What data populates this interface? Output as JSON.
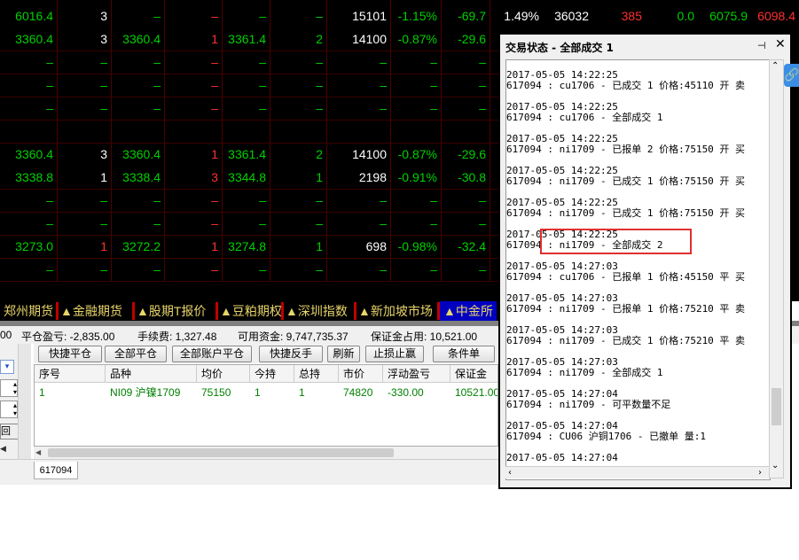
{
  "quote_table": {
    "rows": [
      [
        "6016.4",
        "3",
        "–",
        "–",
        "–",
        "–",
        "15101",
        "-1.15%",
        "-69.7",
        "1.49%",
        "36032",
        "385",
        "0.0",
        "6075.9",
        "6098.4"
      ],
      [
        "3360.4",
        "3",
        "3360.4",
        "1",
        "3361.4",
        "2",
        "14100",
        "-0.87%",
        "-29.6",
        "",
        "",
        "",
        "",
        "",
        ""
      ],
      [
        "–",
        "–",
        "–",
        "–",
        "–",
        "–",
        "–",
        "–",
        "–",
        "",
        "",
        "",
        "",
        "",
        ""
      ],
      [
        "–",
        "–",
        "–",
        "–",
        "–",
        "–",
        "–",
        "–",
        "–",
        "",
        "",
        "",
        "",
        "",
        ""
      ],
      [
        "–",
        "–",
        "–",
        "–",
        "–",
        "–",
        "–",
        "–",
        "–",
        "",
        "",
        "",
        "",
        "",
        ""
      ],
      [
        "3360.4",
        "3",
        "3360.4",
        "1",
        "3361.4",
        "2",
        "14100",
        "-0.87%",
        "-29.6",
        "",
        "",
        "",
        "",
        "",
        ""
      ],
      [
        "3338.8",
        "1",
        "3338.4",
        "3",
        "3344.8",
        "1",
        "2198",
        "-0.91%",
        "-30.8",
        "",
        "",
        "",
        "",
        "",
        ""
      ],
      [
        "–",
        "–",
        "–",
        "–",
        "–",
        "–",
        "–",
        "–",
        "–",
        "",
        "",
        "",
        "",
        "",
        ""
      ],
      [
        "–",
        "–",
        "–",
        "–",
        "–",
        "–",
        "–",
        "–",
        "–",
        "",
        "",
        "",
        "",
        "",
        ""
      ],
      [
        "3273.0",
        "1",
        "3272.2",
        "1",
        "3274.8",
        "1",
        "698",
        "-0.98%",
        "-32.4",
        "",
        "",
        "",
        "",
        "",
        ""
      ],
      [
        "–",
        "–",
        "–",
        "–",
        "–",
        "–",
        "–",
        "–",
        "–",
        "",
        "",
        "",
        "",
        "",
        ""
      ]
    ],
    "colors": {
      "up": "#00d000",
      "down": "#ff3030",
      "neutral": "#ffffff",
      "dash_green": "#00d000",
      "dash_red": "#ff3030"
    }
  },
  "exchange_tabs": [
    "郑州期货",
    "▲金融期货",
    "▲股期T报价",
    "▲豆粕期权",
    "▲深圳指数",
    "▲新加坡市场",
    "▲中金所"
  ],
  "account_bar": {
    "prefix": "00",
    "close_pl": "平仓盈亏: -2,835.00",
    "fee": "手续费: 1,327.48",
    "available": "可用资金: 9,747,735.37",
    "margin": "保证金占用: 10,521.00"
  },
  "toolbar": [
    "快捷平仓",
    "全部平仓",
    "全部账户平仓",
    "快捷反手",
    "刷新",
    "止损止赢",
    "条件单"
  ],
  "positions": {
    "headers": [
      "序号",
      "品种",
      "均价",
      "今持",
      "总持",
      "市价",
      "浮动盈亏",
      "保证金"
    ],
    "rows": [
      [
        "1",
        "NI09 沪镍1709",
        "75150",
        "1",
        "1",
        "74820",
        "-330.00",
        "10521.00"
      ]
    ]
  },
  "account_tab": "617094",
  "left_panel": {
    "button_label": "回"
  },
  "dialog": {
    "title": "交易状态 - 全部成交 1",
    "entries": [
      {
        "time": "2017-05-05 14:22:25",
        "msg": "617094 : cu1706 - 已成交 1 价格:45110 开 卖"
      },
      {
        "time": "2017-05-05 14:22:25",
        "msg": "617094 : cu1706 - 全部成交 1"
      },
      {
        "time": "2017-05-05 14:22:25",
        "msg": "617094 : ni1709 - 已报单 2 价格:75150 开 买"
      },
      {
        "time": "2017-05-05 14:22:25",
        "msg": "617094 : ni1709 - 已成交 1 价格:75150 开 买"
      },
      {
        "time": "2017-05-05 14:22:25",
        "msg": "617094 : ni1709 - 已成交 1 价格:75150 开 买"
      },
      {
        "time": "2017-05-05 14:22:25",
        "msg": "617094 : ni1709 - 全部成交 2"
      },
      {
        "time": "2017-05-05 14:27:03",
        "msg": "617094 : cu1706 - 已报单 1 价格:45150 平 买"
      },
      {
        "time": "2017-05-05 14:27:03",
        "msg": "617094 : ni1709 - 已报单 1 价格:75210 平 卖"
      },
      {
        "time": "2017-05-05 14:27:03",
        "msg": "617094 : ni1709 - 已成交 1 价格:75210 平 卖"
      },
      {
        "time": "2017-05-05 14:27:03",
        "msg": "617094 : ni1709 - 全部成交 1"
      },
      {
        "time": "2017-05-05 14:27:04",
        "msg": "617094 : ni1709 - 可平数量不足"
      },
      {
        "time": "2017-05-05 14:27:04",
        "msg": "617094 : CU06 沪铜1706 - 已撤单 量:1"
      },
      {
        "time": "2017-05-05 14:27:04",
        "msg": ""
      }
    ]
  },
  "highlight_color": "#e03030"
}
